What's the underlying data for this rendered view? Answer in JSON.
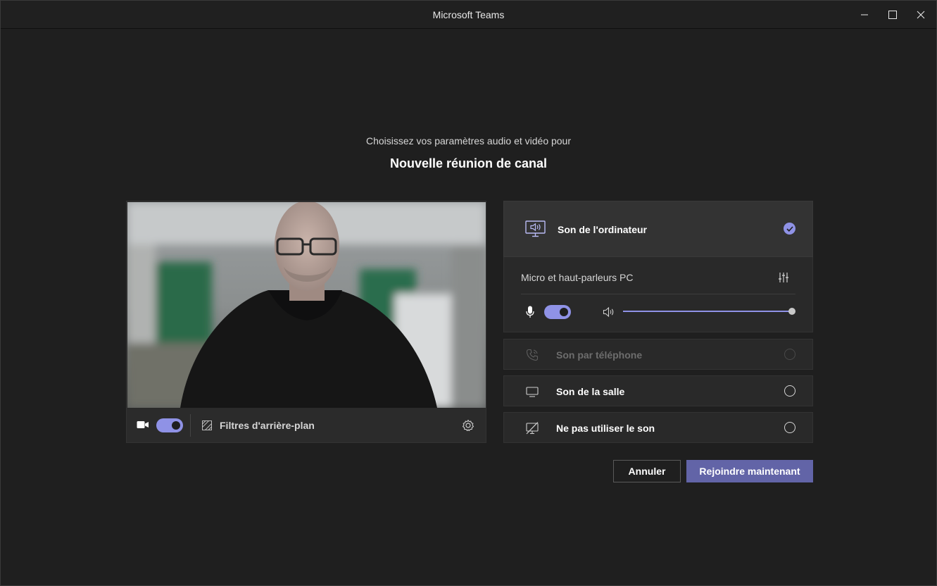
{
  "window": {
    "title": "Microsoft Teams",
    "controls": [
      "minimize",
      "maximize",
      "close"
    ]
  },
  "header": {
    "subtitle": "Choisissez vos paramètres audio et vidéo pour",
    "meeting_title": "Nouvelle réunion de canal"
  },
  "video": {
    "camera_on": true,
    "filters_label": "Filtres d'arrière-plan",
    "settings_icon": "gear-icon"
  },
  "audio": {
    "selected_option": {
      "label": "Son de l'ordinateur",
      "icon": "computer-audio-icon",
      "checked": true,
      "device_label": "Micro et haut-parleurs PC",
      "mic_on": true,
      "volume_level": 1.0
    },
    "options": [
      {
        "label": "Son par téléphone",
        "icon": "phone-icon",
        "disabled": true
      },
      {
        "label": "Son de la salle",
        "icon": "room-device-icon",
        "disabled": false
      },
      {
        "label": "Ne pas utiliser le son",
        "icon": "no-audio-icon",
        "disabled": false
      }
    ]
  },
  "actions": {
    "cancel_label": "Annuler",
    "join_label": "Rejoindre maintenant"
  },
  "colors": {
    "accent": "#6264a7",
    "toggle": "#8f92e6",
    "background": "#1f1f1f"
  }
}
